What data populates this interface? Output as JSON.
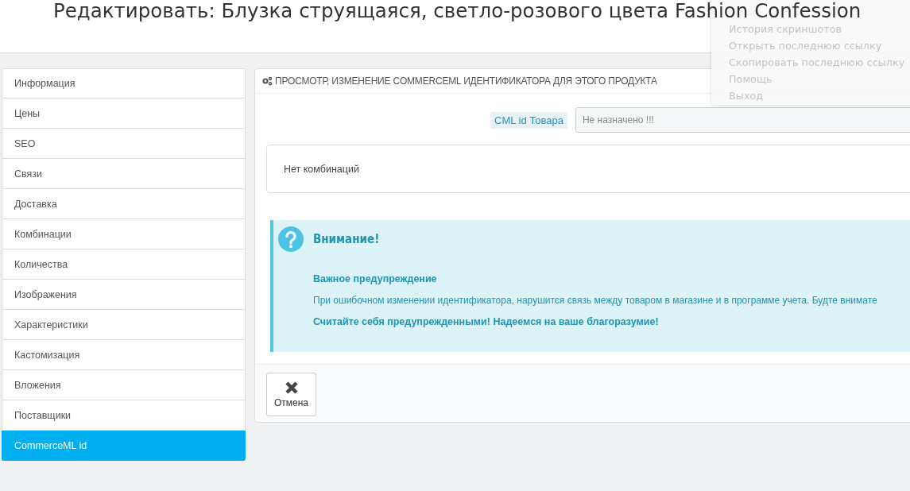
{
  "page_title": "Редактировать: Блузка струящаяся, светло-розового цвета Fashion Confession",
  "sidebar": {
    "items": [
      {
        "label": "Информация",
        "selected": false
      },
      {
        "label": "Цены",
        "selected": false
      },
      {
        "label": "SEO",
        "selected": false
      },
      {
        "label": "Связи",
        "selected": false
      },
      {
        "label": "Доставка",
        "selected": false
      },
      {
        "label": "Комбинации",
        "selected": false
      },
      {
        "label": "Количества",
        "selected": false
      },
      {
        "label": "Изображения",
        "selected": false
      },
      {
        "label": "Характеристики",
        "selected": false
      },
      {
        "label": "Кастомизация",
        "selected": false
      },
      {
        "label": "Вложения",
        "selected": false
      },
      {
        "label": "Поставщики",
        "selected": false
      },
      {
        "label": "CommerceML id",
        "selected": true
      }
    ]
  },
  "panel": {
    "heading": "ПРОСМОТР, ИЗМЕНЕНИЕ COMMERCEML ИДЕНТИФИКАТОРА ДЛЯ ЭТОГО ПРОДУКТА",
    "field": {
      "label": "CML id Товара",
      "placeholder": "Не назначено !!!"
    },
    "combinations_note": "Нет комбинаций",
    "alert": {
      "title": "Внимание!",
      "subtitle": "Важное предупреждение",
      "text": "При ошибочном изменении идентификатора, нарушится связь между товаром в магазине и в программе учета. Будте внимате",
      "footer": "Считайте себя предупрежденными! Надеемся на ваше благоразумие!"
    },
    "cancel_button": "Отмена"
  },
  "context_menu": {
    "items": [
      "История скриншотов",
      "Открыть последнюю ссылку",
      "Скопировать последнюю ссылку",
      "Помощь",
      "Выход"
    ]
  }
}
